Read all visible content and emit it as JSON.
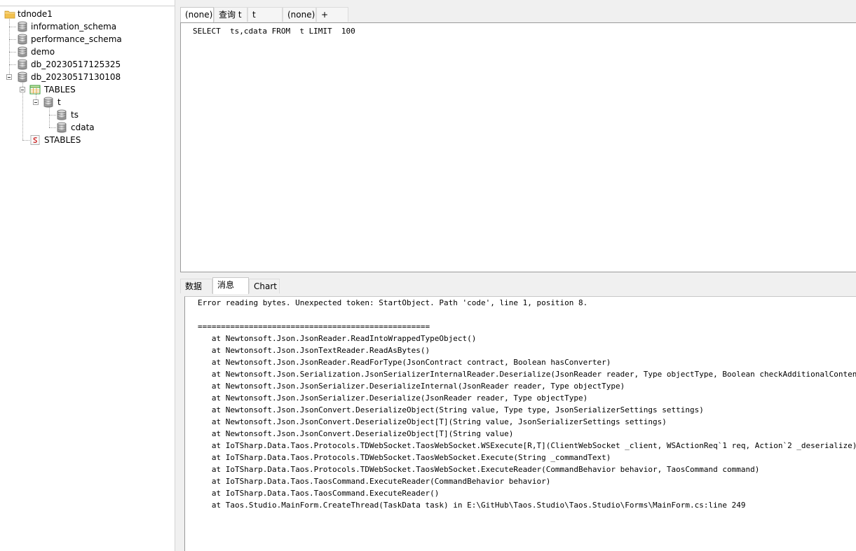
{
  "tree": {
    "root": "tdnode1",
    "databases": [
      "information_schema",
      "performance_schema",
      "demo",
      "db_20230517125325",
      "db_20230517130108"
    ],
    "tables_folder": "TABLES",
    "table": "t",
    "columns": [
      "ts",
      "cdata"
    ],
    "stables_folder": "STABLES"
  },
  "query_tabs": [
    "(none)",
    "查询",
    "t",
    "t",
    "(none)",
    "+"
  ],
  "sql": "SELECT  ts,cdata FROM  t LIMIT  100",
  "result_tabs": [
    "数据",
    "消息",
    "Chart"
  ],
  "messages": [
    "Error reading bytes. Unexpected token: StartObject. Path 'code', line 1, position 8.",
    "",
    "==================================================",
    "   at Newtonsoft.Json.JsonReader.ReadIntoWrappedTypeObject()",
    "   at Newtonsoft.Json.JsonTextReader.ReadAsBytes()",
    "   at Newtonsoft.Json.JsonReader.ReadForType(JsonContract contract, Boolean hasConverter)",
    "   at Newtonsoft.Json.Serialization.JsonSerializerInternalReader.Deserialize(JsonReader reader, Type objectType, Boolean checkAdditionalContent)",
    "   at Newtonsoft.Json.JsonSerializer.DeserializeInternal(JsonReader reader, Type objectType)",
    "   at Newtonsoft.Json.JsonSerializer.Deserialize(JsonReader reader, Type objectType)",
    "   at Newtonsoft.Json.JsonConvert.DeserializeObject(String value, Type type, JsonSerializerSettings settings)",
    "   at Newtonsoft.Json.JsonConvert.DeserializeObject[T](String value, JsonSerializerSettings settings)",
    "   at Newtonsoft.Json.JsonConvert.DeserializeObject[T](String value)",
    "   at IoTSharp.Data.Taos.Protocols.TDWebSocket.TaosWebSocket.WSExecute[R,T](ClientWebSocket _client, WSActionReq`1 req, Action`2 _deserialize)",
    "   at IoTSharp.Data.Taos.Protocols.TDWebSocket.TaosWebSocket.Execute(String _commandText)",
    "   at IoTSharp.Data.Taos.Protocols.TDWebSocket.TaosWebSocket.ExecuteReader(CommandBehavior behavior, TaosCommand command)",
    "   at IoTSharp.Data.Taos.TaosCommand.ExecuteReader(CommandBehavior behavior)",
    "   at IoTSharp.Data.Taos.TaosCommand.ExecuteReader()",
    "   at Taos.Studio.MainForm.CreateThread(TaskData task) in E:\\GitHub\\Taos.Studio\\Taos.Studio\\Forms\\MainForm.cs:line 249"
  ],
  "icons": {
    "server": "folder-icon",
    "database": "database-icon",
    "tables": "table-grid-icon",
    "stables": "stable-s-icon",
    "column": "column-icon"
  },
  "colors": {
    "folder": "#f2c14e",
    "stable_red": "#cc2222",
    "table_green": "#3a9a3a"
  }
}
